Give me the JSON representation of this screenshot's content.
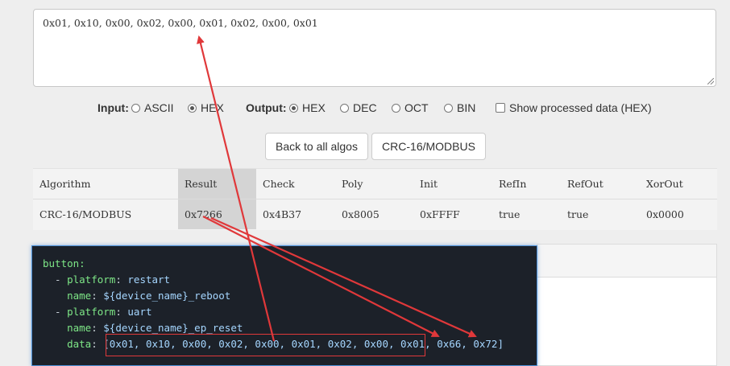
{
  "input": {
    "value": "0x01, 0x10, 0x00, 0x02, 0x00, 0x01, 0x02, 0x00, 0x01"
  },
  "options": {
    "input_label": "Input:",
    "input_ascii": "ASCII",
    "input_hex": "HEX",
    "input_selected": "HEX",
    "output_label": "Output:",
    "output_hex": "HEX",
    "output_dec": "DEC",
    "output_oct": "OCT",
    "output_bin": "BIN",
    "output_selected": "HEX",
    "show_processed": "Show processed data (HEX)"
  },
  "buttons": {
    "back": "Back to all algos",
    "algo": "CRC-16/MODBUS"
  },
  "table": {
    "headers": [
      "Algorithm",
      "Result",
      "Check",
      "Poly",
      "Init",
      "RefIn",
      "RefOut",
      "XorOut"
    ],
    "row": [
      "CRC-16/MODBUS",
      "0x7266",
      "0x4B37",
      "0x8005",
      "0xFFFF",
      "true",
      "true",
      "0x0000"
    ]
  },
  "code": {
    "l1": "button:",
    "l2_dash": "  - ",
    "l2_key": "platform",
    "l2_val": "restart",
    "l3_key": "name",
    "l3_val": "${device_name}_reboot",
    "l4_key": "platform",
    "l4_val": "uart",
    "l5_key": "name",
    "l5_val": "${device_name}_ep_reset",
    "l6_key": "data",
    "l6_val": "[0x01, 0x10, 0x00, 0x02, 0x00, 0x01, 0x02, 0x00, 0x01, 0x66, 0x72]"
  },
  "colors": {
    "annotation": "#e0383a",
    "code_bg": "#1c2129",
    "code_key": "#7ee787",
    "code_value": "#a5d6ff"
  }
}
